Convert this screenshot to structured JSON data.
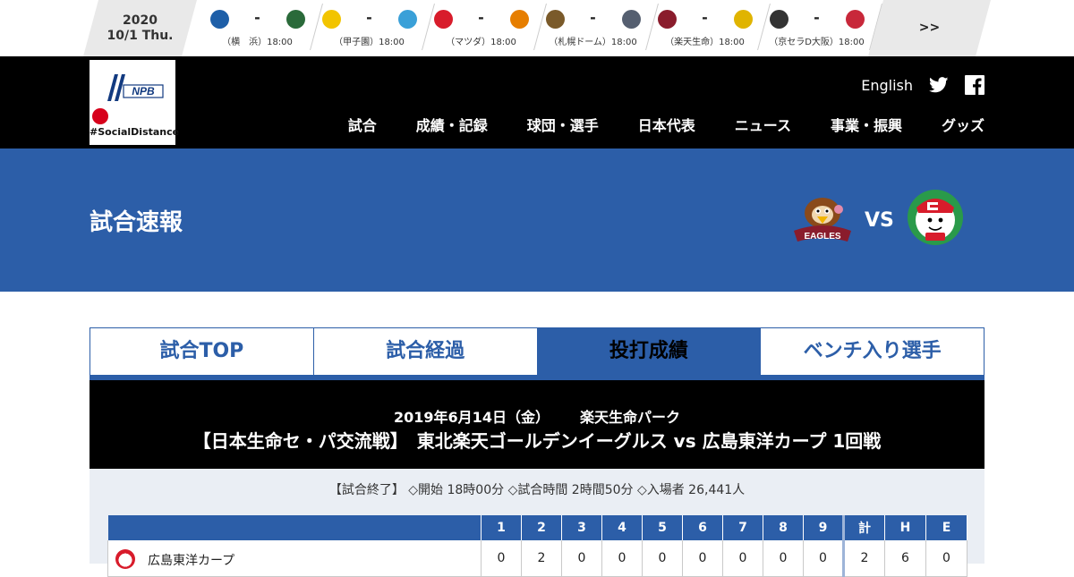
{
  "ticker": {
    "year": "2020",
    "date": "10/1 Thu.",
    "more": ">>",
    "games": [
      {
        "home_icon": "baystars-logo",
        "away_icon": "dragons-logo",
        "score": "-",
        "venue": "（横　浜）18:00",
        "home_color": "#1e5fa8",
        "away_color": "#2a6a3a"
      },
      {
        "home_icon": "tigers-logo",
        "away_icon": "swallows-logo",
        "score": "-",
        "venue": "（甲子園）18:00",
        "home_color": "#f2c400",
        "away_color": "#3aa0d8"
      },
      {
        "home_icon": "carp-logo",
        "away_icon": "giants-logo",
        "score": "-",
        "venue": "（マツダ）18:00",
        "home_color": "#d81c2b",
        "away_color": "#e67e00"
      },
      {
        "home_icon": "fighters-logo",
        "away_icon": "lions-logo",
        "score": "-",
        "venue": "（札幌ドーム）18:00",
        "home_color": "#7a5a2a",
        "away_color": "#555f70"
      },
      {
        "home_icon": "eagles-logo",
        "away_icon": "hawks-logo",
        "score": "-",
        "venue": "（楽天生命）18:00",
        "home_color": "#8a1c2c",
        "away_color": "#e0b400"
      },
      {
        "home_icon": "buffaloes-logo",
        "away_icon": "marines-logo",
        "score": "-",
        "venue": "（京セラD大阪）18:00",
        "home_color": "#333333",
        "away_color": "#c8283a"
      }
    ]
  },
  "header": {
    "logo_text": "NPB",
    "logo_tagline": "#SocialDistance",
    "language": "English",
    "nav": [
      "試合",
      "成績・記録",
      "球団・選手",
      "日本代表",
      "ニュース",
      "事業・振興",
      "グッズ"
    ]
  },
  "hero": {
    "title": "試合速報",
    "vs": "VS",
    "home_logo": "eagles-logo",
    "away_logo": "carp-logo"
  },
  "tabs": [
    {
      "label": "試合TOP",
      "active": false
    },
    {
      "label": "試合経過",
      "active": false
    },
    {
      "label": "投打成績",
      "active": true
    },
    {
      "label": "ベンチ入り選手",
      "active": false
    }
  ],
  "game": {
    "date": "2019年6月14日（金）",
    "stadium": "楽天生命パーク",
    "title": "【日本生命セ・パ交流戦】　東北楽天ゴールデンイーグルス vs 広島東洋カープ 1回戦",
    "status": "【試合終了】 ◇開始 18時00分 ◇試合時間 2時間50分 ◇入場者 26,441人"
  },
  "linescore": {
    "headers": [
      "1",
      "2",
      "3",
      "4",
      "5",
      "6",
      "7",
      "8",
      "9",
      "計",
      "H",
      "E"
    ],
    "rows": [
      {
        "team": "広島東洋カープ",
        "icon": "carp-logo",
        "scores": [
          "0",
          "2",
          "0",
          "0",
          "0",
          "0",
          "0",
          "0",
          "0",
          "2",
          "6",
          "0"
        ]
      }
    ]
  },
  "colors": {
    "brand_blue": "#2c5ea8",
    "header_black": "#000000",
    "info_bg": "#eaeef4"
  }
}
